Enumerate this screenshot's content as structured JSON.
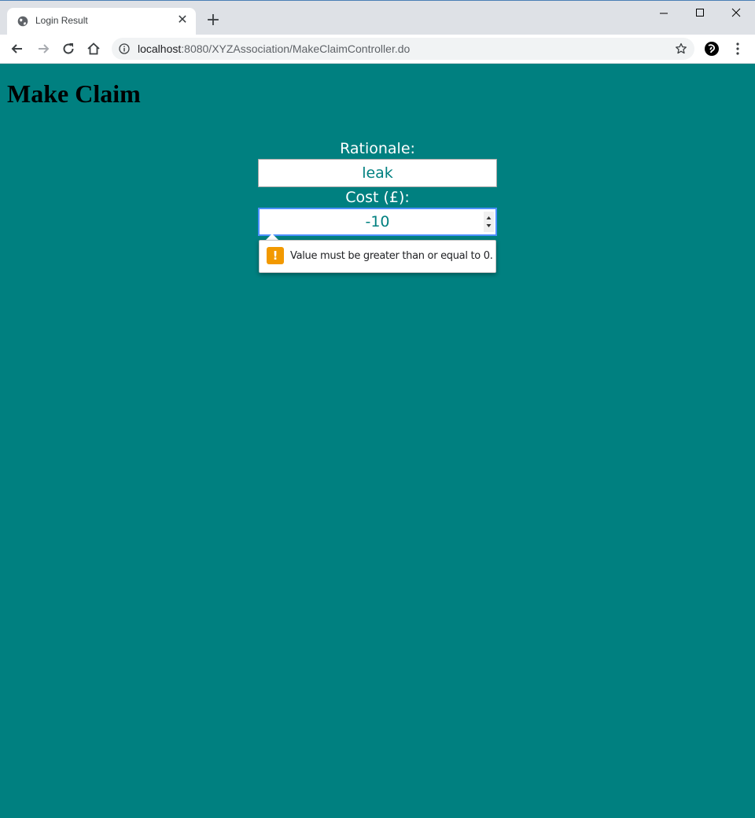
{
  "browser": {
    "tab": {
      "title": "Login Result"
    },
    "address": {
      "host": "localhost",
      "path": ":8080/XYZAssociation/MakeClaimController.do"
    }
  },
  "page": {
    "title": "Make Claim",
    "form": {
      "rationale_label": "Rationale:",
      "rationale_value": "leak",
      "cost_label": "Cost (£):",
      "cost_value": "-10"
    },
    "validation": {
      "message": "Value must be greater than or equal to 0.",
      "icon": "warning-icon",
      "color": "#f29900"
    },
    "background_color": "#008080"
  }
}
